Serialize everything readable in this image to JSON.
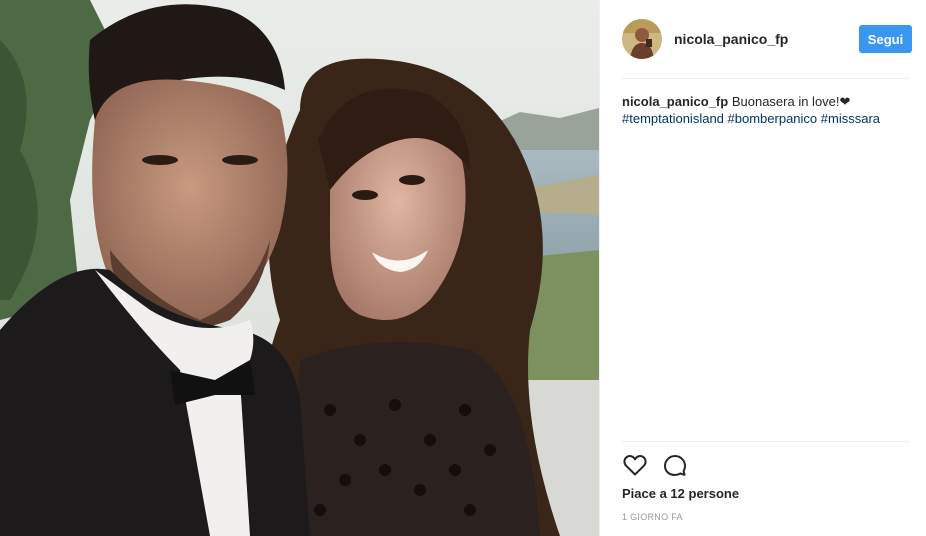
{
  "post": {
    "username": "nicola_panico_fp",
    "follow_label": "Segui",
    "caption": {
      "username": "nicola_panico_fp",
      "text": "Buonasera in love!",
      "heart": "❤",
      "hashtags": [
        "#temptationisland",
        "#bomberpanico",
        "#misssara"
      ]
    },
    "likes_text": "Piace a 12 persone",
    "time_text": "1 GIORNO FA"
  },
  "icons": {
    "like": "heart-outline-icon",
    "comment": "comment-bubble-icon"
  },
  "colors": {
    "follow_button": "#3897f0",
    "hashtag": "#003569",
    "text": "#262626",
    "muted": "#999999"
  }
}
